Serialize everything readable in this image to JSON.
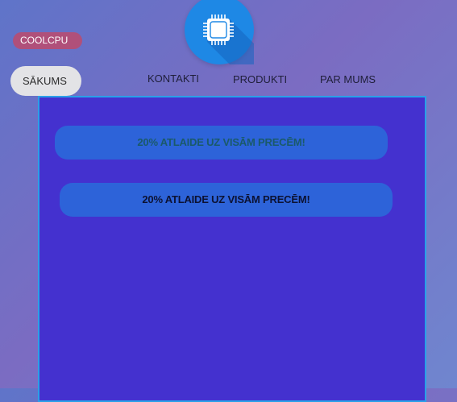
{
  "header": {
    "brand_label": "COOLCPU",
    "home_label": "SĀKUMS",
    "logo_icon": "cpu-chip-icon",
    "nav": [
      {
        "label": "KONTAKTI"
      },
      {
        "label": "PRODUKTI"
      },
      {
        "label": "PAR MUMS"
      }
    ]
  },
  "main": {
    "promos": [
      {
        "label": "20% ATLAIDE UZ VISĀM PRECĒM!"
      },
      {
        "label": "20% ATLAIDE UZ VISĀM PRECĒM!"
      }
    ]
  },
  "colors": {
    "panel": "#4431cf",
    "panel_border": "#2aa0e8",
    "promo": "#2d63d9",
    "logo_circle": "#1e88e5",
    "brand_pill": "#b0507a",
    "home_pill": "#e3e3e6"
  }
}
